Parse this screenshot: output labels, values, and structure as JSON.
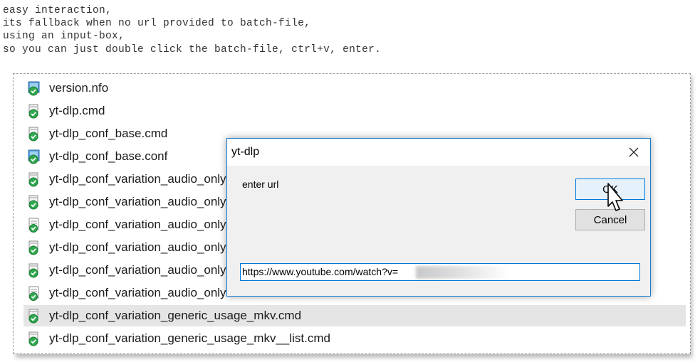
{
  "notes": {
    "lines": [
      "easy interaction,",
      "its fallback when no url provided to batch-file,",
      "using an input-box,",
      "so you can just double click the batch-file, ctrl+v, enter."
    ]
  },
  "explorer": {
    "files": [
      {
        "name": "version.nfo",
        "icon": "nfo-file-icon"
      },
      {
        "name": "yt-dlp.cmd",
        "icon": "cmd-file-icon"
      },
      {
        "name": "yt-dlp_conf_base.cmd",
        "icon": "cmd-file-icon"
      },
      {
        "name": "yt-dlp_conf_base.conf",
        "icon": "conf-file-icon"
      },
      {
        "name": "yt-dlp_conf_variation_audio_only",
        "icon": "cmd-file-icon"
      },
      {
        "name": "yt-dlp_conf_variation_audio_only",
        "icon": "cmd-file-icon"
      },
      {
        "name": "yt-dlp_conf_variation_audio_only",
        "icon": "list-file-icon"
      },
      {
        "name": "yt-dlp_conf_variation_audio_only",
        "icon": "cmd-file-icon"
      },
      {
        "name": "yt-dlp_conf_variation_audio_only",
        "icon": "cmd-file-icon"
      },
      {
        "name": "yt-dlp_conf_variation_audio_only",
        "icon": "list-file-icon"
      },
      {
        "name": "yt-dlp_conf_variation_generic_usage_mkv.cmd",
        "icon": "cmd-file-icon",
        "selected": true
      },
      {
        "name": "yt-dlp_conf_variation_generic_usage_mkv__list.cmd",
        "icon": "cmd-file-icon"
      }
    ]
  },
  "dialog": {
    "title": "yt-dlp",
    "prompt": "enter url",
    "ok_label": "OK",
    "cancel_label": "Cancel",
    "url_value": "https://www.youtube.com/watch?v=",
    "close_icon": "close-icon"
  },
  "colors": {
    "dialog_border": "#1979ca",
    "ok_button_bg": "#e5f1fb",
    "ok_button_border": "#0078d7",
    "selected_row": "#e5e5e5"
  }
}
